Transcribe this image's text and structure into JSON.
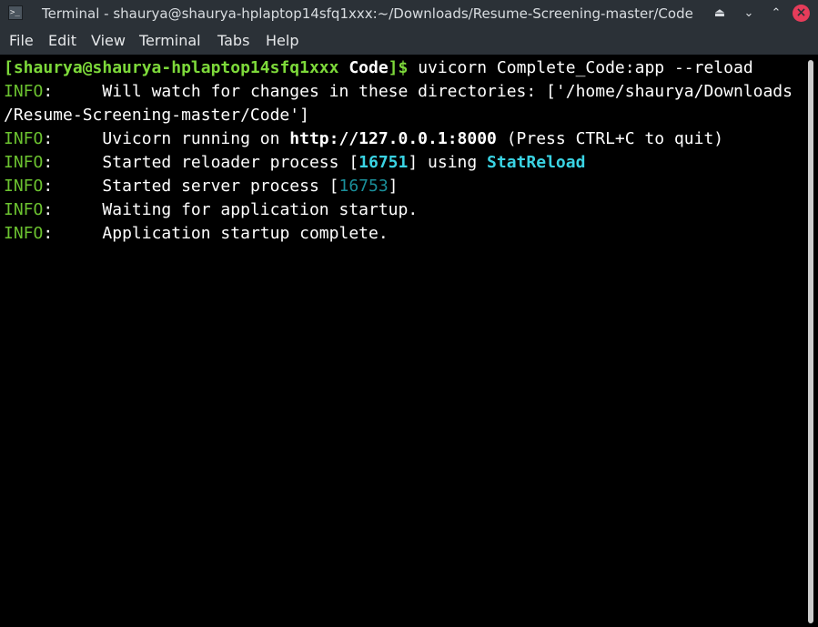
{
  "window": {
    "title": "Terminal - shaurya@shaurya-hplaptop14sfq1xxx:~/Downloads/Resume-Screening-master/Code",
    "app_icon_glyph": ">_",
    "buttons": {
      "keep_above": "⏏",
      "minimize": "⌄",
      "maximize": "⌃",
      "close": "×"
    }
  },
  "menubar": {
    "items": [
      "File",
      "Edit",
      "View",
      "Terminal",
      "Tabs",
      "Help"
    ]
  },
  "terminal": {
    "prompt": {
      "open_bracket": "[",
      "user_host": "shaurya@shaurya-hplaptop14sfq1xxx",
      "space": " ",
      "dir": "Code",
      "close": "]$",
      "command": " uvicorn Complete_Code:app --reload"
    },
    "lines": [
      {
        "level": "INFO",
        "sep": ":     ",
        "text": "Will watch for changes in these directories: ['/home/shaurya/Downloads"
      },
      {
        "continuation": "/Resume-Screening-master/Code']"
      },
      {
        "level": "INFO",
        "sep": ":     ",
        "pre": "Uvicorn running on ",
        "url": "http://127.0.0.1:8000",
        "post": " (Press CTRL+C to quit)"
      },
      {
        "level": "INFO",
        "sep": ":     ",
        "pre": "Started reloader process [",
        "pid": "16751",
        "mid": "] using ",
        "reloader": "StatReload"
      },
      {
        "level": "INFO",
        "sep": ":     ",
        "pre": "Started server process [",
        "pid": "16753",
        "post": "]"
      },
      {
        "level": "INFO",
        "sep": ":     ",
        "text": "Waiting for application startup."
      },
      {
        "level": "INFO",
        "sep": ":     ",
        "text": "Application startup complete."
      }
    ]
  },
  "colors": {
    "chrome_bg": "#2b3137",
    "terminal_bg": "#000000",
    "prompt_green": "#7dd93a",
    "info_green": "#6cc330",
    "pid_cyan": "#3ad3e3",
    "pid_dark_cyan": "#1a8f9a",
    "close_red": "#e63c5a"
  }
}
